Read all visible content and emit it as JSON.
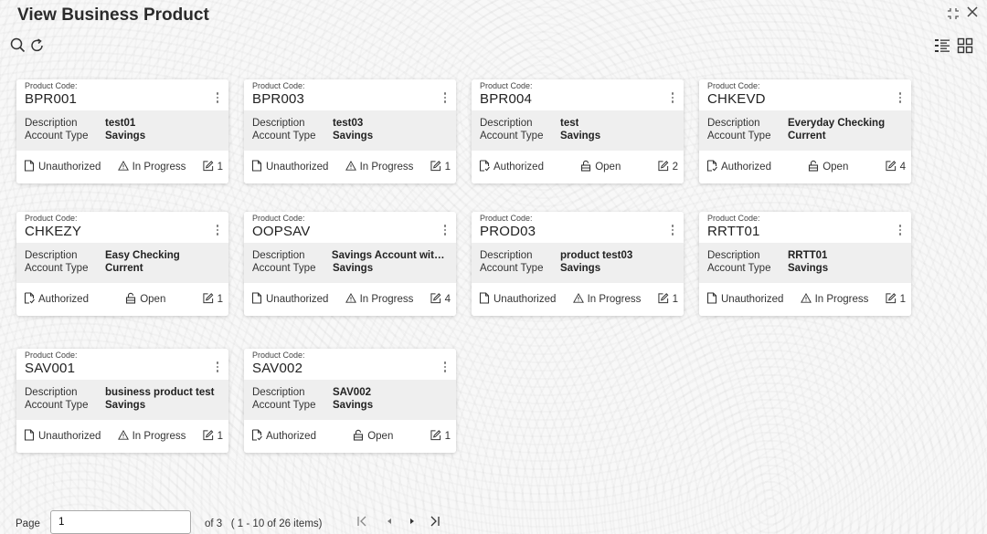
{
  "header": {
    "title": "View Business Product"
  },
  "cards_labels": {
    "code_label": "Product Code:",
    "desc_label": "Description",
    "acct_label": "Account Type"
  },
  "cards": [
    {
      "code": "BPR001",
      "description": "test01",
      "account_type": "Savings",
      "auth": "Unauthorized",
      "status": "In Progress",
      "count": "1"
    },
    {
      "code": "BPR003",
      "description": "test03",
      "account_type": "Savings",
      "auth": "Unauthorized",
      "status": "In Progress",
      "count": "1"
    },
    {
      "code": "BPR004",
      "description": "test",
      "account_type": "Savings",
      "auth": "Authorized",
      "status": "Open",
      "count": "2"
    },
    {
      "code": "CHKEVD",
      "description": "Everyday Checking",
      "account_type": "Current",
      "auth": "Authorized",
      "status": "Open",
      "count": "4"
    },
    {
      "code": "CHKEZY",
      "description": "Easy Checking",
      "account_type": "Current",
      "auth": "Authorized",
      "status": "Open",
      "count": "1"
    },
    {
      "code": "OOPSAV",
      "description": "Savings Account with...",
      "account_type": "Savings",
      "auth": "Unauthorized",
      "status": "In Progress",
      "count": "4"
    },
    {
      "code": "PROD03",
      "description": "product test03",
      "account_type": "Savings",
      "auth": "Unauthorized",
      "status": "In Progress",
      "count": "1"
    },
    {
      "code": "RRTT01",
      "description": "RRTT01",
      "account_type": "Savings",
      "auth": "Unauthorized",
      "status": "In Progress",
      "count": "1"
    },
    {
      "code": "SAV001",
      "description": "business product test",
      "account_type": "Savings",
      "auth": "Unauthorized",
      "status": "In Progress",
      "count": "1"
    },
    {
      "code": "SAV002",
      "description": "SAV002",
      "account_type": "Savings",
      "auth": "Authorized",
      "status": "Open",
      "count": "1"
    }
  ],
  "pager": {
    "page_label": "Page",
    "page_value": "1",
    "of_text": "of 3",
    "items_text": "( 1 - 10 of 26 items)"
  },
  "icons": {
    "search": "search-icon",
    "refresh": "refresh-icon",
    "list_view": "list-view-icon",
    "grid_view": "grid-view-icon",
    "maximize": "maximize-icon",
    "close": "close-icon"
  }
}
